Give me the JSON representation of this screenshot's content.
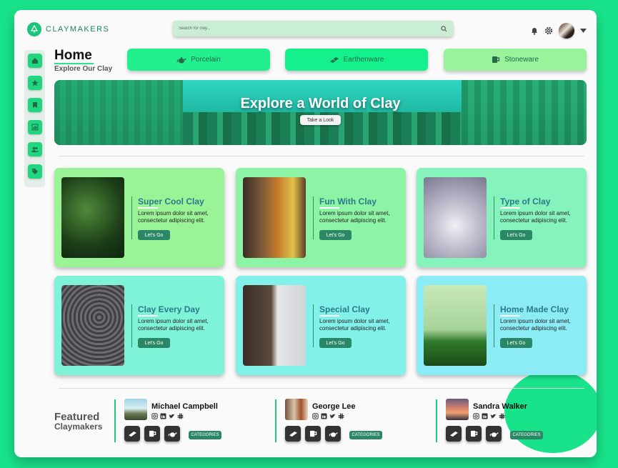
{
  "header": {
    "logo": "CLAYMAKERS",
    "search_placeholder": "Search for clay..."
  },
  "page": {
    "title": "Home",
    "subtitle": "Explore Our Clay"
  },
  "categories": [
    {
      "label": "Porcelain",
      "icon": "teapot-icon",
      "color": "#22ef8e"
    },
    {
      "label": "Earthenware",
      "icon": "brick-icon",
      "color": "#14f08c"
    },
    {
      "label": "Stoneware",
      "icon": "mug-icon",
      "color": "#9af39a"
    }
  ],
  "banner": {
    "heading": "Explore a World of Clay",
    "button": "Take a Look"
  },
  "cards": [
    {
      "title": "Super Cool Clay",
      "text": "Lorem ipsum dolor sit amet, consectetur adipiscing elit.",
      "button": "Let's Go",
      "color": "#9bf397"
    },
    {
      "title": "Fun With Clay",
      "text": "Lorem ipsum dolor sit amet, consectetur adipiscing elit.",
      "button": "Let's Go",
      "color": "#8df3a5"
    },
    {
      "title": "Type of Clay",
      "text": "Lorem ipsum dolor sit amet, consectetur adipiscing elit.",
      "button": "Let's Go",
      "color": "#86f3bd"
    },
    {
      "title": "Clay Every Day",
      "text": "Lorem ipsum dolor sit amet, consectetur adipiscing elit.",
      "button": "Let's Go",
      "color": "#7ff3d7"
    },
    {
      "title": "Special Clay",
      "text": "Lorem ipsum dolor sit amet, consectetur adipiscing elit.",
      "button": "Let's Go",
      "color": "#82f1ea"
    },
    {
      "title": "Home Made Clay",
      "text": "Lorem ipsum dolor sit amet, consectetur adipiscing elit.",
      "button": "Let's Go",
      "color": "#8cecf5"
    }
  ],
  "featured": {
    "line1": "Featured",
    "line2": "Claymakers",
    "makers": [
      {
        "name": "Michael Campbell",
        "categories_label": "CATEGORIES"
      },
      {
        "name": "George Lee",
        "categories_label": "CATEGORIES"
      },
      {
        "name": "Sandra Walker",
        "categories_label": "CATEGORIES"
      }
    ]
  }
}
